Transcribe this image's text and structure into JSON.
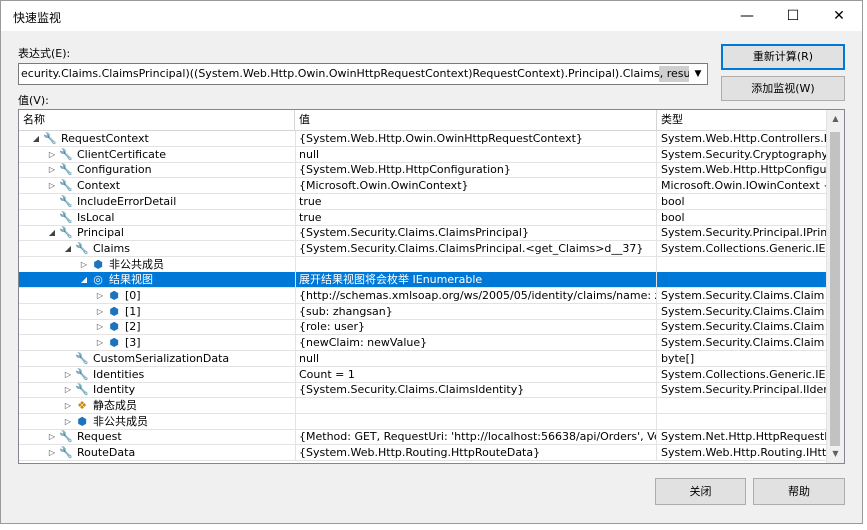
{
  "window": {
    "title": "快速监视"
  },
  "title_buttons": {
    "minimize": "—",
    "maximize": "☐",
    "close": "✕"
  },
  "expression": {
    "label": "表达式(E):",
    "value": "ecurity.Claims.ClaimsPrincipal)((System.Web.Http.Owin.OwinHttpRequestContext)RequestContext).Principal).Claims, results"
  },
  "values_label": "值(V):",
  "buttons": {
    "recalculate": "重新计算(R)",
    "add_watch": "添加监视(W)",
    "close": "关闭",
    "help": "帮助"
  },
  "columns": {
    "name": "名称",
    "value": "值",
    "type": "类型"
  },
  "rows": [
    {
      "name": "RequestContext",
      "value": "{System.Web.Http.Owin.OwinHttpRequestContext}",
      "type": "System.Web.Http.Controllers.Htt..."
    },
    {
      "name": "ClientCertificate",
      "value": "null",
      "type": "System.Security.Cryptography.X..."
    },
    {
      "name": "Configuration",
      "value": "{System.Web.Http.HttpConfiguration}",
      "type": "System.Web.Http.HttpConfigur..."
    },
    {
      "name": "Context",
      "value": "{Microsoft.Owin.OwinContext}",
      "type": "Microsoft.Owin.IOwinContext {..."
    },
    {
      "name": "IncludeErrorDetail",
      "value": "true",
      "type": "bool"
    },
    {
      "name": "IsLocal",
      "value": "true",
      "type": "bool"
    },
    {
      "name": "Principal",
      "value": "{System.Security.Claims.ClaimsPrincipal}",
      "type": "System.Security.Principal.IPrinci..."
    },
    {
      "name": "Claims",
      "value": "{System.Security.Claims.ClaimsPrincipal.<get_Claims>d__37}",
      "type": "System.Collections.Generic.IEnu..."
    },
    {
      "name": "非公共成员",
      "value": "",
      "type": ""
    },
    {
      "name": "结果视图",
      "value": "展开结果视图将会枚举 IEnumerable",
      "type": ""
    },
    {
      "name": "[0]",
      "value": "{http://schemas.xmlsoap.org/ws/2005/05/identity/claims/name: zhang...",
      "type": "System.Security.Claims.Claim"
    },
    {
      "name": "[1]",
      "value": "{sub: zhangsan}",
      "type": "System.Security.Claims.Claim"
    },
    {
      "name": "[2]",
      "value": "{role: user}",
      "type": "System.Security.Claims.Claim"
    },
    {
      "name": "[3]",
      "value": "{newClaim: newValue}",
      "type": "System.Security.Claims.Claim"
    },
    {
      "name": "CustomSerializationData",
      "value": "null",
      "type": "byte[]"
    },
    {
      "name": "Identities",
      "value": "Count = 1",
      "type": "System.Collections.Generic.IEnu..."
    },
    {
      "name": "Identity",
      "value": "{System.Security.Claims.ClaimsIdentity}",
      "type": "System.Security.Principal.IIdenti..."
    },
    {
      "name": "静态成员",
      "value": "",
      "type": ""
    },
    {
      "name": "非公共成员",
      "value": "",
      "type": ""
    },
    {
      "name": "Request",
      "value": "{Method: GET, RequestUri: 'http://localhost:56638/api/Orders', Version: ...",
      "type": "System.Net.Http.HttpRequestM..."
    },
    {
      "name": "RouteData",
      "value": "{System.Web.Http.Routing.HttpRouteData}",
      "type": "System.Web.Http.Routing.IHttp..."
    }
  ],
  "colors": {
    "selection": "#0078d7",
    "wrench": "#3c3c3c",
    "cube": "#1e73be",
    "results": "#c0392b"
  }
}
